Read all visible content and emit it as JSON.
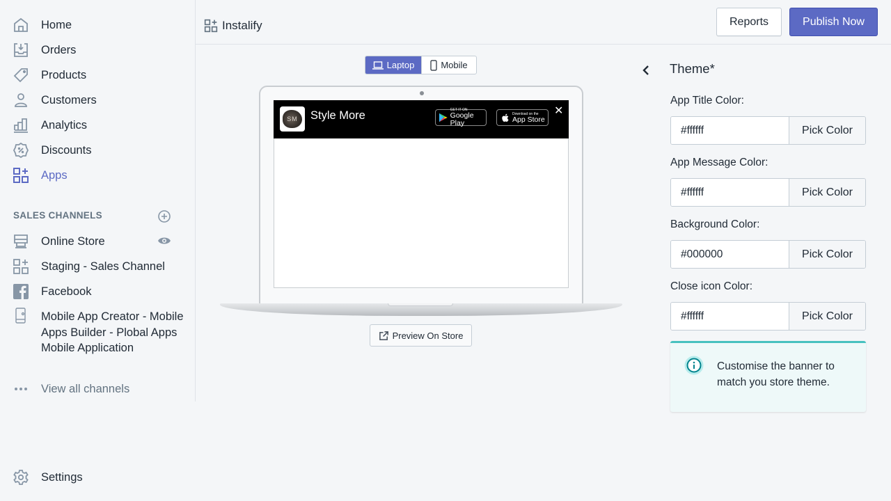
{
  "sidebar": {
    "main_items": [
      {
        "label": "Home",
        "icon": "home-icon"
      },
      {
        "label": "Orders",
        "icon": "orders-icon"
      },
      {
        "label": "Products",
        "icon": "tag-icon"
      },
      {
        "label": "Customers",
        "icon": "person-icon"
      },
      {
        "label": "Analytics",
        "icon": "bar-chart-icon"
      },
      {
        "label": "Discounts",
        "icon": "discount-icon"
      },
      {
        "label": "Apps",
        "icon": "apps-icon",
        "active": true
      }
    ],
    "sales_channels_title": "SALES CHANNELS",
    "channels": [
      {
        "label": "Online Store",
        "icon": "store-icon"
      },
      {
        "label": "Staging - Sales Channel",
        "icon": "apps-icon"
      },
      {
        "label": "Facebook",
        "icon": "facebook-icon"
      },
      {
        "label": "Mobile App Creator - Mobile Apps Builder - Plobal Apps Mobile Application",
        "icon": "mobile-icon"
      }
    ],
    "view_all": "View all channels",
    "settings": "Settings"
  },
  "header": {
    "app_name": "Instalify",
    "reports_label": "Reports",
    "publish_label": "Publish Now"
  },
  "preview": {
    "toggle": {
      "laptop": "Laptop",
      "mobile": "Mobile",
      "selected": "Laptop"
    },
    "banner": {
      "app_icon_text": "SM",
      "title": "Style More",
      "google_play_small": "GET IT ON",
      "google_play_big": "Google Play",
      "app_store_small": "Download on the",
      "app_store_big": "App Store",
      "close": "✕"
    },
    "preview_button": "Preview On Store"
  },
  "theme": {
    "title": "Theme*",
    "fields": [
      {
        "label": "App Title Color:",
        "value": "#ffffff",
        "button": "Pick Color"
      },
      {
        "label": "App Message Color:",
        "value": "#ffffff",
        "button": "Pick Color"
      },
      {
        "label": "Background Color:",
        "value": "#000000",
        "button": "Pick Color"
      },
      {
        "label": "Close icon Color:",
        "value": "#ffffff",
        "button": "Pick Color"
      }
    ],
    "info": "Customise the banner to match you store theme."
  },
  "colors": {
    "accent": "#5c6ac4",
    "info_border": "#47c1bf",
    "info_bg": "#eef9f9"
  }
}
